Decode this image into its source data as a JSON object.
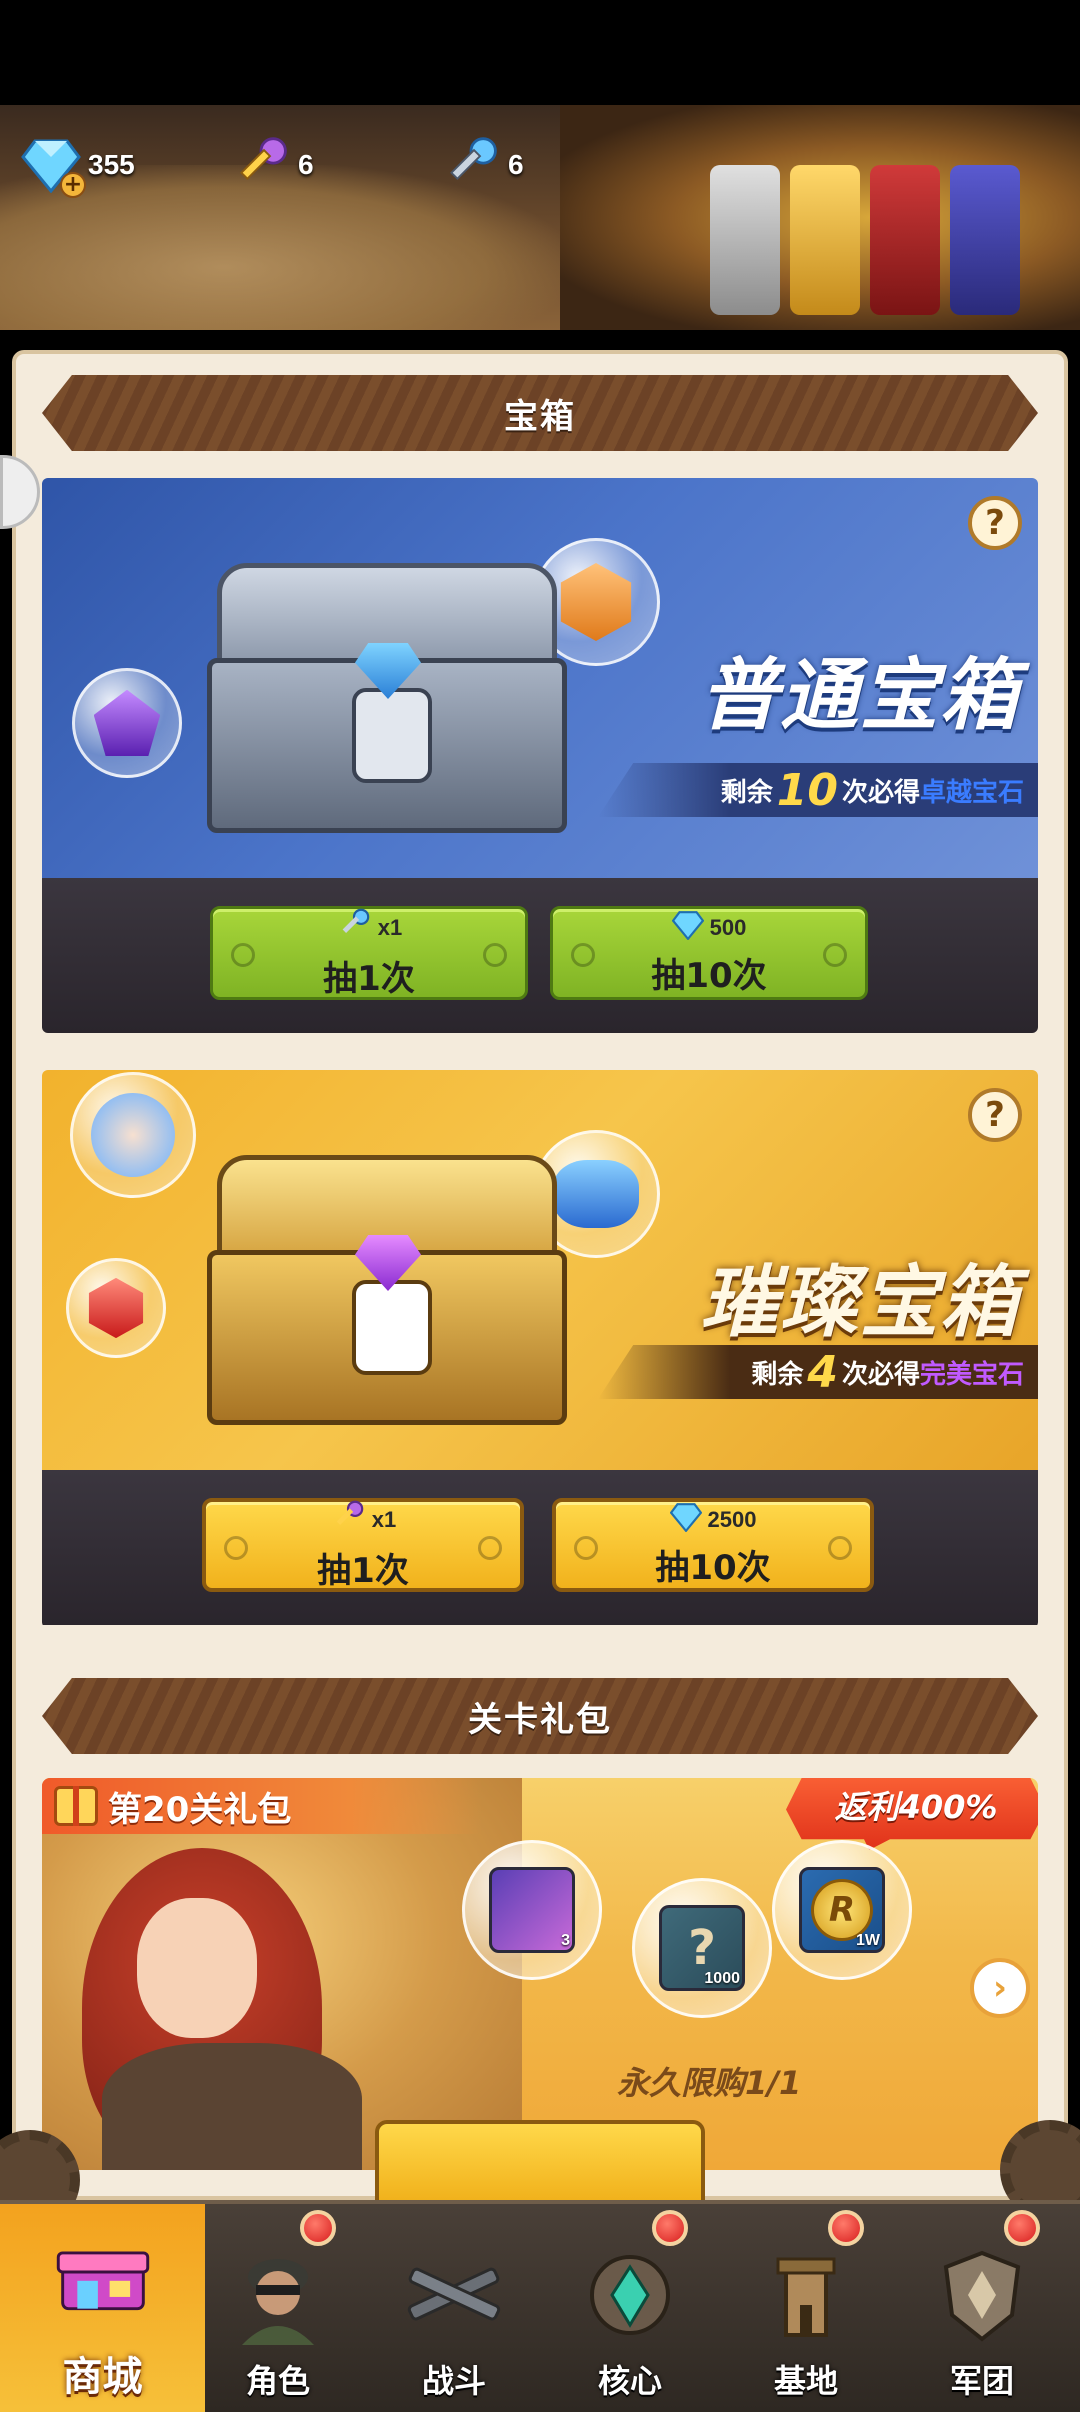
{
  "resources": [
    {
      "name": "diamond",
      "icon": "diamond-icon",
      "value": "355"
    },
    {
      "name": "purple-key",
      "icon": "purple-key-icon",
      "value": "6"
    },
    {
      "name": "blue-key",
      "icon": "blue-key-icon",
      "value": "6"
    }
  ],
  "sections": {
    "chests_title": "宝箱",
    "stage_gift_title": "关卡礼包"
  },
  "common_chest": {
    "name": "普通宝箱",
    "pity_prefix": "剩余",
    "pity_count": "10",
    "pity_mid": "次必得",
    "pity_reward": "卓越宝石",
    "pity_reward_color": "#3a7cff",
    "buttons": [
      {
        "cost": "x1",
        "cost_icon": "blue-key-icon",
        "label": "抽1次"
      },
      {
        "cost": "500",
        "cost_icon": "diamond-icon",
        "label": "抽10次"
      }
    ]
  },
  "rare_chest": {
    "name": "璀璨宝箱",
    "pity_prefix": "剩余",
    "pity_count": "4",
    "pity_mid": "次必得",
    "pity_reward": "完美宝石",
    "pity_reward_color": "#b04aff",
    "buttons": [
      {
        "cost": "x1",
        "cost_icon": "purple-key-icon",
        "label": "抽1次"
      },
      {
        "cost": "2500",
        "cost_icon": "diamond-icon",
        "label": "抽10次"
      }
    ]
  },
  "stage_gift": {
    "title": "第20关礼包",
    "rebate": "返利400%",
    "items": [
      {
        "icon": "crystal-icon",
        "qty": "3"
      },
      {
        "icon": "scroll-icon",
        "qty": "1000"
      },
      {
        "icon": "coin-icon",
        "qty": "1W"
      }
    ],
    "limit": "永久限购1/1"
  },
  "nav": [
    {
      "label": "商城",
      "icon": "shop-icon",
      "active": true,
      "badge": false
    },
    {
      "label": "角色",
      "icon": "soldier-icon",
      "active": false,
      "badge": true
    },
    {
      "label": "战斗",
      "icon": "crossed-guns-icon",
      "active": false,
      "badge": false
    },
    {
      "label": "核心",
      "icon": "core-emblem-icon",
      "active": false,
      "badge": true
    },
    {
      "label": "基地",
      "icon": "base-tower-icon",
      "active": false,
      "badge": true
    },
    {
      "label": "军团",
      "icon": "legion-shield-icon",
      "active": false,
      "badge": true
    }
  ],
  "colors": {
    "accent_gold": "#f6c13a",
    "accent_green": "#8ec42c",
    "pity_number": "#ffd94a"
  }
}
